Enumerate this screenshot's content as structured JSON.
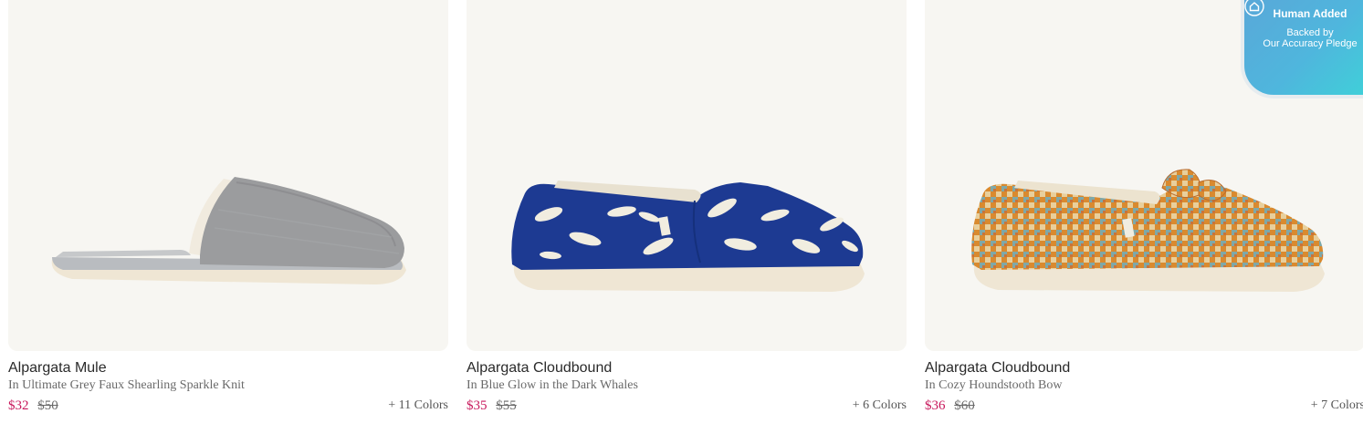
{
  "products": [
    {
      "name": "Alpargata Mule",
      "color": "In Ultimate Grey Faux Shearling Sparkle Knit",
      "sale_price": "$32",
      "original_price": "$50",
      "colors": "+ 11 Colors",
      "image": "grey-knit-mule-shoe"
    },
    {
      "name": "Alpargata Cloudbound",
      "color": "In Blue Glow in the Dark Whales",
      "sale_price": "$35",
      "original_price": "$55",
      "colors": "+ 6 Colors",
      "image": "blue-whale-print-slip-on-shoe"
    },
    {
      "name": "Alpargata Cloudbound",
      "color": "In Cozy Houndstooth Bow",
      "sale_price": "$36",
      "original_price": "$60",
      "colors": "+ 7 Colors",
      "image": "orange-houndstooth-bow-slip-on-shoe"
    }
  ],
  "badge": {
    "title": "Human Added",
    "line1": "Backed by",
    "line2": "Our Accuracy Pledge",
    "icons": [
      "check-circle-icon",
      "home-shield-icon"
    ]
  },
  "colors": {
    "sale": "#c8195c",
    "image_bg": "#f7f6f2",
    "badge_start": "#5aa7d8",
    "badge_end": "#3ed2d8"
  }
}
